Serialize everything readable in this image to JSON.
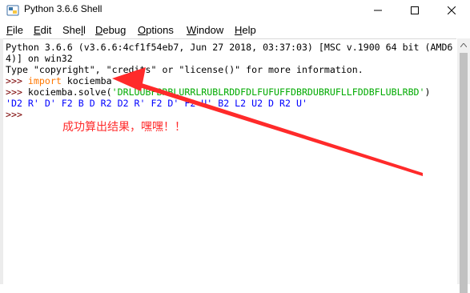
{
  "window": {
    "title": "Python 3.6.6 Shell",
    "icons": {
      "app": "python-idle-icon",
      "minimize": "minimize-icon",
      "maximize": "maximize-icon",
      "close": "close-icon"
    }
  },
  "menu": [
    {
      "label": "File",
      "underline": "F",
      "rest": "ile"
    },
    {
      "label": "Edit",
      "underline": "E",
      "rest": "dit"
    },
    {
      "label": "Shell",
      "pre": "She",
      "underline": "l",
      "rest": "l"
    },
    {
      "label": "Debug",
      "underline": "D",
      "rest": "ebug"
    },
    {
      "label": "Options",
      "underline": "O",
      "rest": "ptions"
    },
    {
      "label": "Window",
      "underline": "W",
      "rest": "indow"
    },
    {
      "label": "Help",
      "underline": "H",
      "rest": "elp"
    }
  ],
  "shell": {
    "banner1": "Python 3.6.6 (v3.6.6:4cf1f54eb7, Jun 27 2018, 03:37:03) [MSC v.1900 64 bit (AMD6",
    "banner2": "4)] on win32",
    "banner3": "Type \"copyright\", \"credits\" or \"license()\" for more information.",
    "prompt": ">>> ",
    "line1_kw": "import",
    "line1_rest": " kociemba",
    "line2_call": "kociemba.solve(",
    "line2_str": "'DRLUUBFBRBLURRLRUBLRDDFDLFUFUFFDBRDUBRUFLLFDDBFLUBLRBD'",
    "line2_close": ")",
    "output": "'D2 R' D' F2 B D R2 D2 R' F2 D' F2 U' B2 L2 U2 D R2 U'",
    "last_prompt": ">>>"
  },
  "annotation": {
    "text": "成功算出结果，嘿嘿！！",
    "color": "#ff2a2a"
  },
  "colors": {
    "prompt": "#7a0000",
    "keyword": "#ff7700",
    "string": "#00aa00",
    "output": "#0000ff"
  }
}
